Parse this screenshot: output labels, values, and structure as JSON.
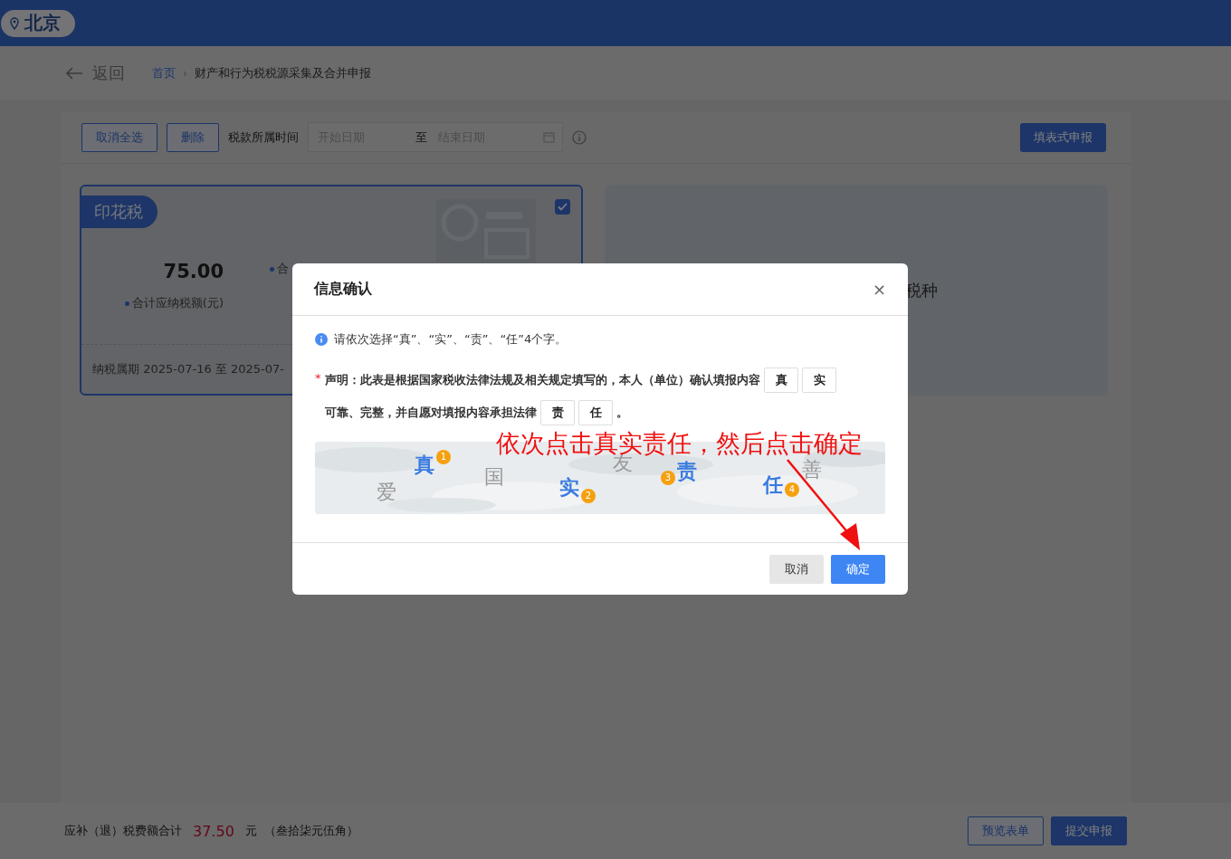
{
  "header": {
    "location": "北京"
  },
  "breadcrumb": {
    "back": "返回",
    "separator": "›",
    "items": [
      {
        "label": "首页",
        "link": true
      },
      {
        "label": "财产和行为税税源采集及合并申报",
        "link": false
      }
    ]
  },
  "toolbar": {
    "buttons": [
      "取消全选",
      "删除"
    ],
    "period_label": "税款所属时间",
    "start_placeholder": "开始日期",
    "separator": "至",
    "end_placeholder": "结束日期",
    "action": "填表式申报"
  },
  "cards": [
    {
      "kind": "tax",
      "tag": "印花税",
      "checked": true,
      "stats": [
        {
          "amount": "75.00",
          "label": "合计应纳税额(元)"
        },
        {
          "label": "合"
        }
      ],
      "period": "纳税属期 2025-07-16 至 2025-07-"
    },
    {
      "kind": "add",
      "label": "税种"
    }
  ],
  "footer": {
    "label": "应补（退）税费额合计",
    "amount": "37.50",
    "unit": "元",
    "amount_words": "（叁拾柒元伍角）",
    "buttons": [
      {
        "label": "预览表单",
        "primary": false
      },
      {
        "label": "提交申报",
        "primary": true
      }
    ]
  },
  "dialog": {
    "title": "信息确认",
    "close": "×",
    "hint": "请依次选择“真”、“实”、“责”、“任”4个字。",
    "required_mark": "*",
    "declaration": [
      [
        {
          "kind": "text",
          "text": "声明：此表是根据国家税收法律法规及相关规定填写的，本人（单位）确认填报内容"
        },
        {
          "kind": "slot",
          "text": "真"
        },
        {
          "kind": "slot",
          "text": "实"
        }
      ],
      [
        {
          "kind": "text",
          "text": "可靠、完整，并自愿对填报内容承担法律"
        },
        {
          "kind": "slot",
          "text": "责"
        },
        {
          "kind": "slot",
          "text": "任"
        },
        {
          "kind": "text",
          "text": "。"
        }
      ]
    ],
    "captcha": [
      {
        "char": "爱",
        "selected": false
      },
      {
        "char": "真",
        "selected": true,
        "order": "1"
      },
      {
        "char": "国",
        "selected": false
      },
      {
        "char": "实",
        "selected": true,
        "order": "2"
      },
      {
        "char": "友",
        "selected": false
      },
      {
        "char": "责",
        "selected": true,
        "order": "3"
      },
      {
        "char": "任",
        "selected": true,
        "order": "4"
      },
      {
        "char": "善",
        "selected": false
      }
    ],
    "buttons": [
      {
        "label": "取消",
        "primary": false
      },
      {
        "label": "确定",
        "primary": true
      }
    ]
  },
  "annotation": {
    "text": "依次点击真实责任，然后点击确定"
  }
}
